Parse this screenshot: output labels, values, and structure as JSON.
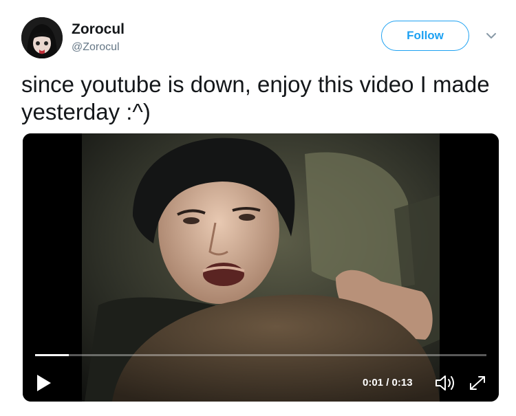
{
  "tweet": {
    "display_name": "Zorocul",
    "handle": "@Zorocul",
    "follow_label": "Follow",
    "text": "since youtube is down, enjoy this video I made yesterday :^)"
  },
  "video": {
    "time": "0:01 / 0:13",
    "progress": 0.075
  },
  "icons": [
    "avatar",
    "chevron-down-icon",
    "play-icon",
    "volume-icon",
    "fullscreen-icon"
  ],
  "colors": {
    "accent": "#1da1f2",
    "text": "#14171a",
    "muted": "#657786"
  }
}
